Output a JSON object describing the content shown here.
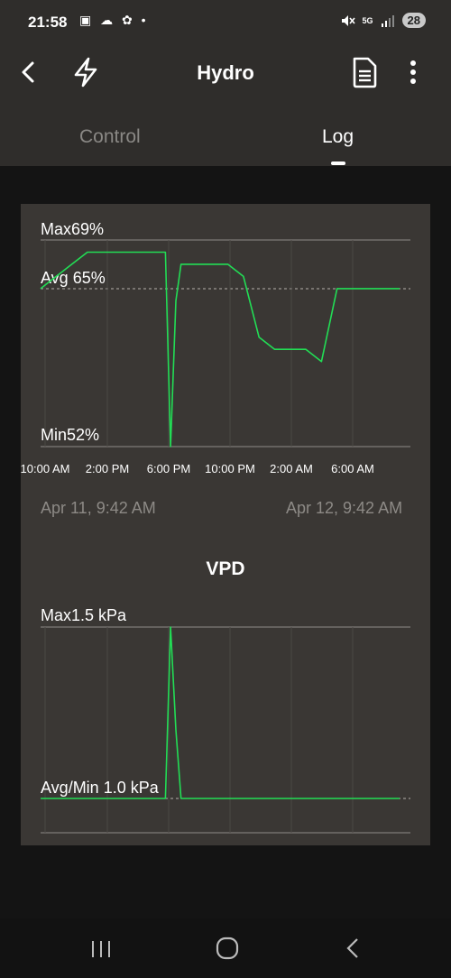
{
  "status_bar": {
    "time": "21:58",
    "left_icons": "▣ ☁ ✿ •",
    "network": "5G",
    "battery": "28"
  },
  "app_bar": {
    "title": "Hydro"
  },
  "tabs": [
    {
      "label": "Control",
      "active": false
    },
    {
      "label": "Log",
      "active": true
    }
  ],
  "humidity_chart": {
    "max_label": "Max69%",
    "avg_label": "Avg 65%",
    "min_label": "Min52%",
    "time_ticks": [
      "10:00 AM",
      "2:00 PM",
      "6:00 PM",
      "10:00 PM",
      "2:00 AM",
      "6:00 AM"
    ],
    "start_date": "Apr 11, 9:42 AM",
    "end_date": "Apr 12, 9:42 AM"
  },
  "vpd_chart": {
    "title": "VPD",
    "max_label": "Max1.5 kPa",
    "avg_min_label": "Avg/Min 1.0 kPa"
  },
  "colors": {
    "line": "#22dd55",
    "card": "#3a3734",
    "bar": "#2f2d2b",
    "background": "#141414"
  },
  "chart_data": [
    {
      "type": "line",
      "y_unit": "%",
      "ylim": [
        52,
        69
      ],
      "x": [
        "10:00 AM",
        "11:00 AM",
        "12:00 PM",
        "1:00 PM",
        "2:00 PM",
        "3:00 PM",
        "4:00 PM",
        "5:00 PM",
        "6:00 PM",
        "6:20 PM",
        "6:40 PM",
        "7:00 PM",
        "8:00 PM",
        "9:00 PM",
        "10:00 PM",
        "11:00 PM",
        "12:00 AM",
        "1:00 AM",
        "2:00 AM",
        "3:00 AM",
        "4:00 AM",
        "5:00 AM",
        "6:00 AM",
        "7:00 AM",
        "8:00 AM",
        "9:00 AM"
      ],
      "series": [
        {
          "values": [
            65,
            66,
            67,
            68,
            68,
            68,
            68,
            68,
            68,
            52,
            64,
            67,
            67,
            67,
            67,
            66,
            61,
            60,
            60,
            60,
            59,
            65,
            65,
            65,
            65,
            65
          ]
        }
      ],
      "annotations": [
        "Max69%",
        "Avg 65%",
        "Min52%"
      ]
    },
    {
      "type": "line",
      "title": "VPD",
      "y_unit": "kPa",
      "ylim": [
        0.9,
        1.5
      ],
      "x": [
        "10:00 AM",
        "2:00 PM",
        "6:00 PM",
        "6:20 PM",
        "6:40 PM",
        "7:00 PM",
        "10:00 PM",
        "2:00 AM",
        "6:00 AM",
        "9:00 AM"
      ],
      "series": [
        {
          "values": [
            1.0,
            1.0,
            1.0,
            1.5,
            1.2,
            1.0,
            1.0,
            1.0,
            1.0,
            1.0
          ]
        }
      ],
      "annotations": [
        "Max1.5 kPa",
        "Avg/Min 1.0 kPa"
      ]
    }
  ]
}
